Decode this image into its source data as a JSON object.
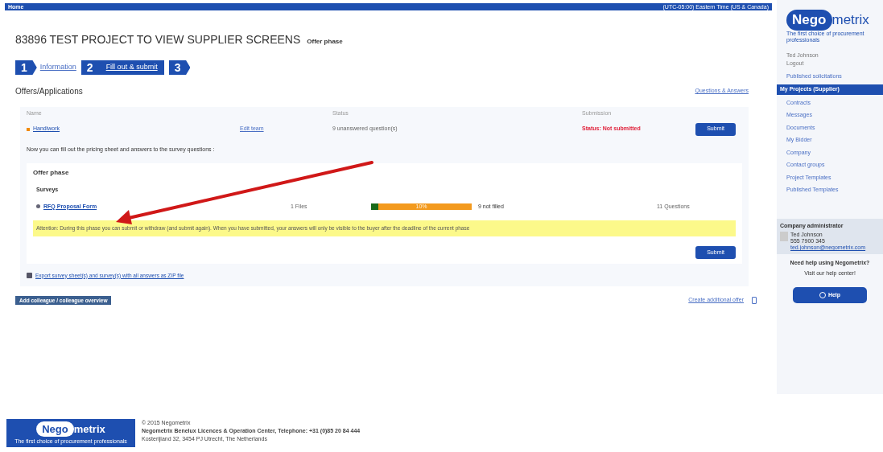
{
  "top_bar": {
    "home": "Home",
    "timezone": "(UTC-05:00) Eastern Time (US & Canada)"
  },
  "header": {
    "title": "83896 TEST PROJECT TO VIEW SUPPLIER SCREENS",
    "phase": "Offer phase"
  },
  "steps": [
    {
      "number": "1",
      "label": "Information",
      "selected": false
    },
    {
      "number": "2",
      "label": "Fill out & submit",
      "selected": true
    },
    {
      "number": "3",
      "selected": false
    }
  ],
  "section": {
    "title": "Offers/Applications",
    "qa_link": "Questions & Answers"
  },
  "table": {
    "columns": [
      "Name",
      "Status",
      "Submission"
    ],
    "rows": [
      {
        "name": "Handiwork",
        "team": "Edit team",
        "status": "9 unanswered question(s)",
        "submission": "Status: Not submitted",
        "button": "Submit"
      }
    ]
  },
  "instruction": "Now you can fill out the pricing sheet and answers to the survey questions :",
  "phase_block": {
    "title": "Offer phase",
    "group": "Surveys",
    "surveys": [
      {
        "name": "RFQ Proposal Form",
        "files": "1 Files",
        "level": 0.07,
        "progress_label": "10%",
        "not_filled": "9 not filled",
        "questions": "11 Questions"
      }
    ]
  },
  "attention": "Attention: During this phase you can submit or withdraw (and submit again). When you have submitted, your answers will only be visible to the buyer after the deadline of the current phase",
  "submit_button": "Submit",
  "export_link": "Export survey sheet(s) and survey(s) with all answers as ZIP file",
  "colleague_button": "Add colleague / colleague overview",
  "create_offer_link": "Create additional offer",
  "sidebar": {
    "logo": {
      "left": "Nego",
      "right": "metrix",
      "tagline": "The first choice of procurement professionals"
    },
    "user": "Ted Johnson",
    "logout": "Logout",
    "items": [
      {
        "label": "Published solicitations",
        "selected": false
      },
      {
        "label": "My Projects (Supplier)",
        "selected": true
      },
      {
        "label": "Contracts",
        "selected": false
      },
      {
        "label": "Messages",
        "selected": false
      },
      {
        "label": "Documents",
        "selected": false
      },
      {
        "label": "My Bidder",
        "selected": false
      },
      {
        "label": "Company",
        "selected": false
      },
      {
        "label": "Contact groups",
        "selected": false
      },
      {
        "label": "Project Templates",
        "selected": false
      },
      {
        "label": "Published Templates",
        "selected": false
      }
    ],
    "admin": {
      "title": "Company administrator",
      "name": "Ted Johnson",
      "phone": "555 7900 345",
      "email": "ted.johnson@negometrix.com"
    },
    "help": {
      "question": "Need help using Negometrix?",
      "link": "Visit our help center!",
      "button": "Help"
    }
  },
  "footer": {
    "logo": {
      "left": "Nego",
      "right": "metrix",
      "tagline": "The first choice of procurement professionals"
    },
    "copyright": "© 2015 Negometrix",
    "office": "Negometrix Benelux Licences & Operation Center, Telephone: +31 (0)85 20 84 444",
    "address": "Kosterijland 32, 3454 PJ Utrecht, The Netherlands"
  }
}
